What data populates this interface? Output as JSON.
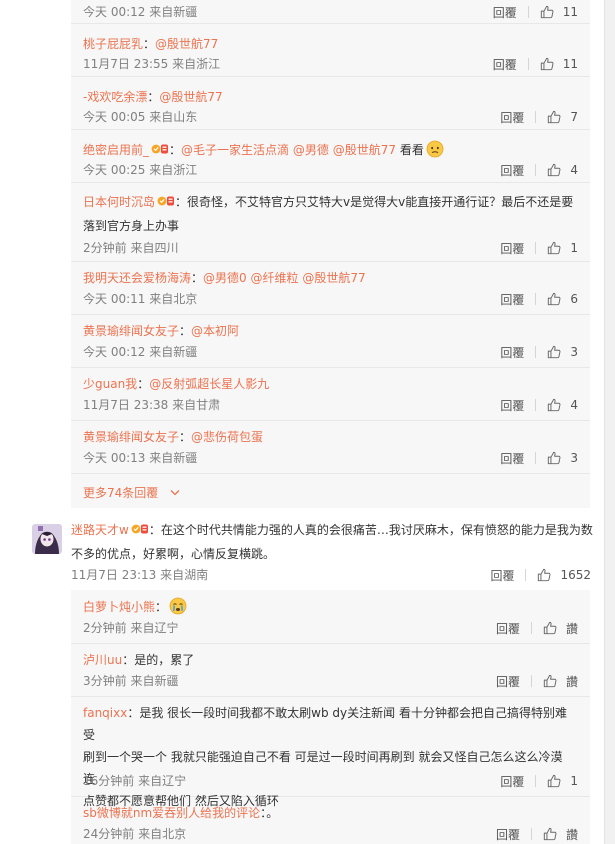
{
  "top_reply": {
    "meta": "今天 00:12 来自新疆",
    "reply_label": "回覆",
    "likes": "11"
  },
  "replies_a": [
    {
      "user": "桃子屁屁乳",
      "sep": "：",
      "mentions": [
        "@殷世航77"
      ],
      "text_after": "",
      "meta": "11月7日 23:55 来自浙江",
      "reply_label": "回覆",
      "likes": "11"
    },
    {
      "user": "-戏欢吃余漂",
      "sep": "：",
      "mentions": [
        "@殷世航77"
      ],
      "text_after": "",
      "meta": "今天 00:05 来自山东",
      "reply_label": "回覆",
      "likes": "7"
    },
    {
      "user": "绝密启用前_",
      "sep": "：",
      "mentions": [
        "@毛子一家生活点滴",
        "@男德",
        "@殷世航77"
      ],
      "text_after": " 看看",
      "meta": "今天 00:25 来自浙江",
      "reply_label": "回覆",
      "likes": "4"
    },
    {
      "user": "日本何时沉岛",
      "sep": "：",
      "text_line1": "很奇怪，不艾特官方只艾特大v是觉得大v能直接开通行证？最后不还是要",
      "text_line2": "落到官方身上办事",
      "meta": "2分钟前 来自四川",
      "reply_label": "回覆",
      "likes": "1"
    },
    {
      "user": "我明天还会爱杨海涛",
      "sep": "：",
      "mentions": [
        "@男德0",
        "@纤维粒",
        "@殷世航77"
      ],
      "text_after": "",
      "meta": "今天 00:11 来自北京",
      "reply_label": "回覆",
      "likes": "6"
    },
    {
      "user": "黄景瑜绯闻女友子",
      "sep": "：",
      "mentions": [
        "@本初阿"
      ],
      "text_after": "",
      "meta": "今天 00:12 来自新疆",
      "reply_label": "回覆",
      "likes": "3"
    },
    {
      "user": "少guan我",
      "sep": "：",
      "mentions": [
        "@反射弧超长星人影九"
      ],
      "text_after": "",
      "meta": "11月7日 23:38 来自甘肃",
      "reply_label": "回覆",
      "likes": "4"
    },
    {
      "user": "黄景瑜绯闻女友子",
      "sep": "：",
      "mentions": [
        "@悲伤荷包蛋"
      ],
      "text_after": "",
      "meta": "今天 00:13 来自新疆",
      "reply_label": "回覆",
      "likes": "3"
    }
  ],
  "more_replies": "更多74条回覆",
  "main_comment": {
    "user": "迷路天才w",
    "sep": "：",
    "text_line1": "在这个时代共情能力强的人真的会很痛苦…我讨厌麻木，保有愤怒的能力是我为数",
    "text_line2": "不多的优点，好累啊，心情反复横跳。",
    "meta": "11月7日 23:13 来自湖南",
    "reply_label": "回覆",
    "likes": "1652"
  },
  "replies_b": [
    {
      "user": "白萝卜炖小熊",
      "sep": "：",
      "text": "",
      "meta": "2分钟前 来自辽宁",
      "reply_label": "回覆",
      "likes": "讚"
    },
    {
      "user": "泸川uu",
      "sep": "：",
      "text": "是的，累了",
      "meta": "3分钟前 来自新疆",
      "reply_label": "回覆",
      "likes": "讚"
    },
    {
      "user": "fanqixx",
      "sep": "：",
      "text_line1": "是我 很长一段时间我都不敢太刷wb dy关注新闻 看十分钟都会把自己搞得特别难受",
      "text_line2": "刷到一个哭一个 我就只能强迫自己不看 可是过一段时间再刷到 就会又怪自己怎么这么冷漠 连",
      "text_line3": "点赞都不愿意帮他们 然后又陷入循环",
      "meta": "16分钟前 来自辽宁",
      "reply_label": "回覆",
      "likes": "1"
    },
    {
      "user": "sb微博就nm爱吞别人给我的评论",
      "sep": "：",
      "text": "。",
      "meta": "24分钟前 来自北京",
      "reply_label": "回覆",
      "likes": "讚"
    }
  ],
  "colors": {
    "accent": "#eb7350",
    "meta": "#808080",
    "reply_bg": "#f7f7f7"
  }
}
